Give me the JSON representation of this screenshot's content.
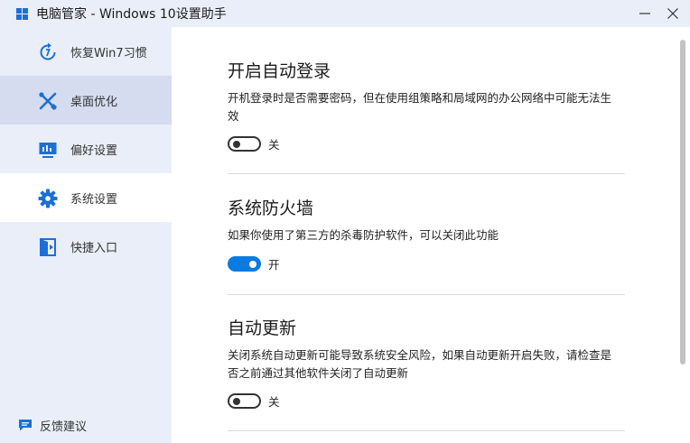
{
  "window": {
    "title": "电脑管家 - Windows 10设置助手",
    "logo_icon": "windows-logo-icon",
    "minimize_icon": "minimize-icon",
    "close_icon": "close-icon"
  },
  "sidebar": {
    "items": [
      {
        "label": "恢复Win7习惯",
        "icon": "restore-clock-icon",
        "state": "normal"
      },
      {
        "label": "桌面优化",
        "icon": "tools-cross-icon",
        "state": "hover"
      },
      {
        "label": "偏好设置",
        "icon": "monitor-icon",
        "state": "normal"
      },
      {
        "label": "系统设置",
        "icon": "gear-icon",
        "state": "active"
      },
      {
        "label": "快捷入口",
        "icon": "entry-door-icon",
        "state": "normal"
      }
    ],
    "feedback": {
      "label": "反馈建议",
      "icon": "chat-bubble-icon"
    }
  },
  "sections": [
    {
      "title": "开启自动登录",
      "description": "开机登录时是否需要密码，但在使用组策略和局域网的办公网络中可能无法生效",
      "toggle": {
        "on": false,
        "label": "关"
      }
    },
    {
      "title": "系统防火墙",
      "description": "如果你使用了第三方的杀毒防护软件，可以关闭此功能",
      "toggle": {
        "on": true,
        "label": "开"
      }
    },
    {
      "title": "自动更新",
      "description": "关闭系统自动更新可能导致系统安全风险，如果自动更新开启失败，请检查是否之前通过其他软件关闭了自动更新",
      "toggle": {
        "on": false,
        "label": "关"
      }
    }
  ],
  "colors": {
    "sidebar_bg": "#e9eef8",
    "hover_bg": "#d5dcef",
    "accent": "#0a7be0",
    "icon_blue": "#1b6fd6"
  }
}
